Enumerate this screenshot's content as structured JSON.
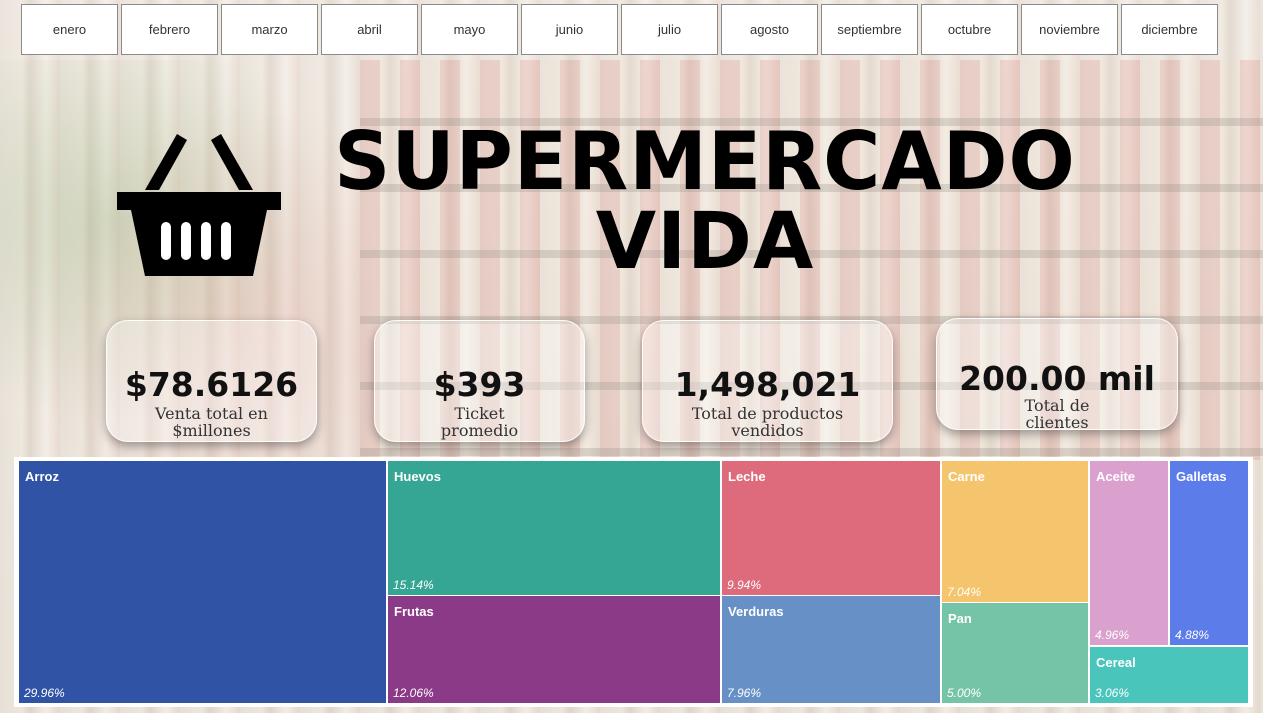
{
  "months": [
    "enero",
    "febrero",
    "marzo",
    "abril",
    "mayo",
    "junio",
    "julio",
    "agosto",
    "septiembre",
    "octubre",
    "noviembre",
    "diciembre"
  ],
  "title": {
    "line1": "SUPERMERCADO",
    "line2": "VIDA"
  },
  "kpis": {
    "sales": {
      "value": "$78.6126",
      "label_line1": "Venta total en",
      "label_line2": "$millones"
    },
    "ticket": {
      "value": "$393",
      "label_line1": "Ticket",
      "label_line2": "promedio"
    },
    "products": {
      "value": "1,498,021",
      "label_line1": "Total de productos",
      "label_line2": "vendidos"
    },
    "clients": {
      "value": "200.00 mil",
      "label_line1": "Total de",
      "label_line2": "clientes"
    }
  },
  "chart_data": {
    "type": "treemap",
    "items": [
      {
        "name": "Arroz",
        "pct_label": "29.96%",
        "value": 29.96,
        "color": "#3153A5"
      },
      {
        "name": "Huevos",
        "pct_label": "15.14%",
        "value": 15.14,
        "color": "#35A693"
      },
      {
        "name": "Frutas",
        "pct_label": "12.06%",
        "value": 12.06,
        "color": "#8B3A87"
      },
      {
        "name": "Leche",
        "pct_label": "9.94%",
        "value": 9.94,
        "color": "#DE6B7C"
      },
      {
        "name": "Verduras",
        "pct_label": "7.96%",
        "value": 7.96,
        "color": "#6690C6"
      },
      {
        "name": "Carne",
        "pct_label": "7.04%",
        "value": 7.04,
        "color": "#F4C56C"
      },
      {
        "name": "Pan",
        "pct_label": "5.00%",
        "value": 5.0,
        "color": "#76C4A8"
      },
      {
        "name": "Aceite",
        "pct_label": "4.96%",
        "value": 4.96,
        "color": "#DBA1CE"
      },
      {
        "name": "Galletas",
        "pct_label": "4.88%",
        "value": 4.88,
        "color": "#5B7CE9"
      },
      {
        "name": "Cereal",
        "pct_label": "3.06%",
        "value": 3.06,
        "color": "#49C5BC"
      }
    ]
  }
}
